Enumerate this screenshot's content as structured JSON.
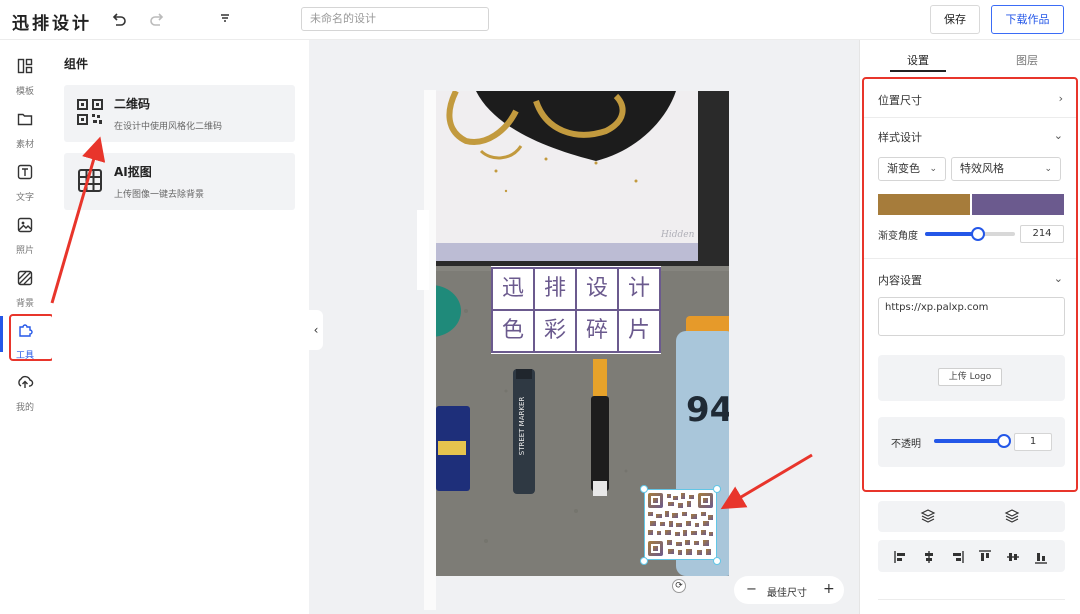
{
  "app": {
    "logo_text": "迅排设计",
    "title_placeholder": "未命名的设计",
    "save_label": "保存",
    "download_label": "下载作品"
  },
  "nav": [
    {
      "id": "templates",
      "label": "模板",
      "icon": "layout-icon"
    },
    {
      "id": "materials",
      "label": "素材",
      "icon": "folder-icon"
    },
    {
      "id": "text",
      "label": "文字",
      "icon": "text-icon"
    },
    {
      "id": "photos",
      "label": "照片",
      "icon": "image-icon"
    },
    {
      "id": "background",
      "label": "背景",
      "icon": "pattern-icon"
    },
    {
      "id": "tools",
      "label": "工具",
      "icon": "puzzle-icon",
      "active": true
    },
    {
      "id": "mine",
      "label": "我的",
      "icon": "cloud-upload-icon"
    }
  ],
  "components": {
    "title": "组件",
    "items": [
      {
        "name": "二维码",
        "desc": "在设计中使用风格化二维码",
        "icon": "qrcode-icon"
      },
      {
        "name": "AI抠图",
        "desc": "上传图像一键去除背景",
        "icon": "ai-cutout-icon"
      }
    ]
  },
  "poster": {
    "grid_text": [
      "迅",
      "排",
      "设",
      "计",
      "色",
      "彩",
      "碎",
      "片"
    ],
    "grid_color": "#6b5a8e"
  },
  "canvas": {
    "zoom_label": "最佳尺寸",
    "zoom_minus": "−",
    "zoom_plus": "+"
  },
  "right_panel": {
    "tab_settings": "设置",
    "tab_layers": "图层",
    "position_size": "位置尺寸",
    "style_design": "样式设计",
    "fill_type": "渐变色",
    "effect_style": "特效风格",
    "gradient_colors": [
      "#a67c3b",
      "#6b5a8e"
    ],
    "gradient_angle_label": "渐变角度",
    "gradient_angle_value": "214",
    "gradient_angle_fraction": 0.59,
    "content_settings": "内容设置",
    "content_url": "https://xp.palxp.com",
    "upload_logo": "上传 Logo",
    "opacity_label": "不透明",
    "opacity_value": "1",
    "opacity_fraction": 1.0
  },
  "colors": {
    "accent": "#2457e8",
    "highlight_red": "#e8352b",
    "qr_gold": "#a67c3b",
    "qr_purple": "#6b5a8e"
  }
}
